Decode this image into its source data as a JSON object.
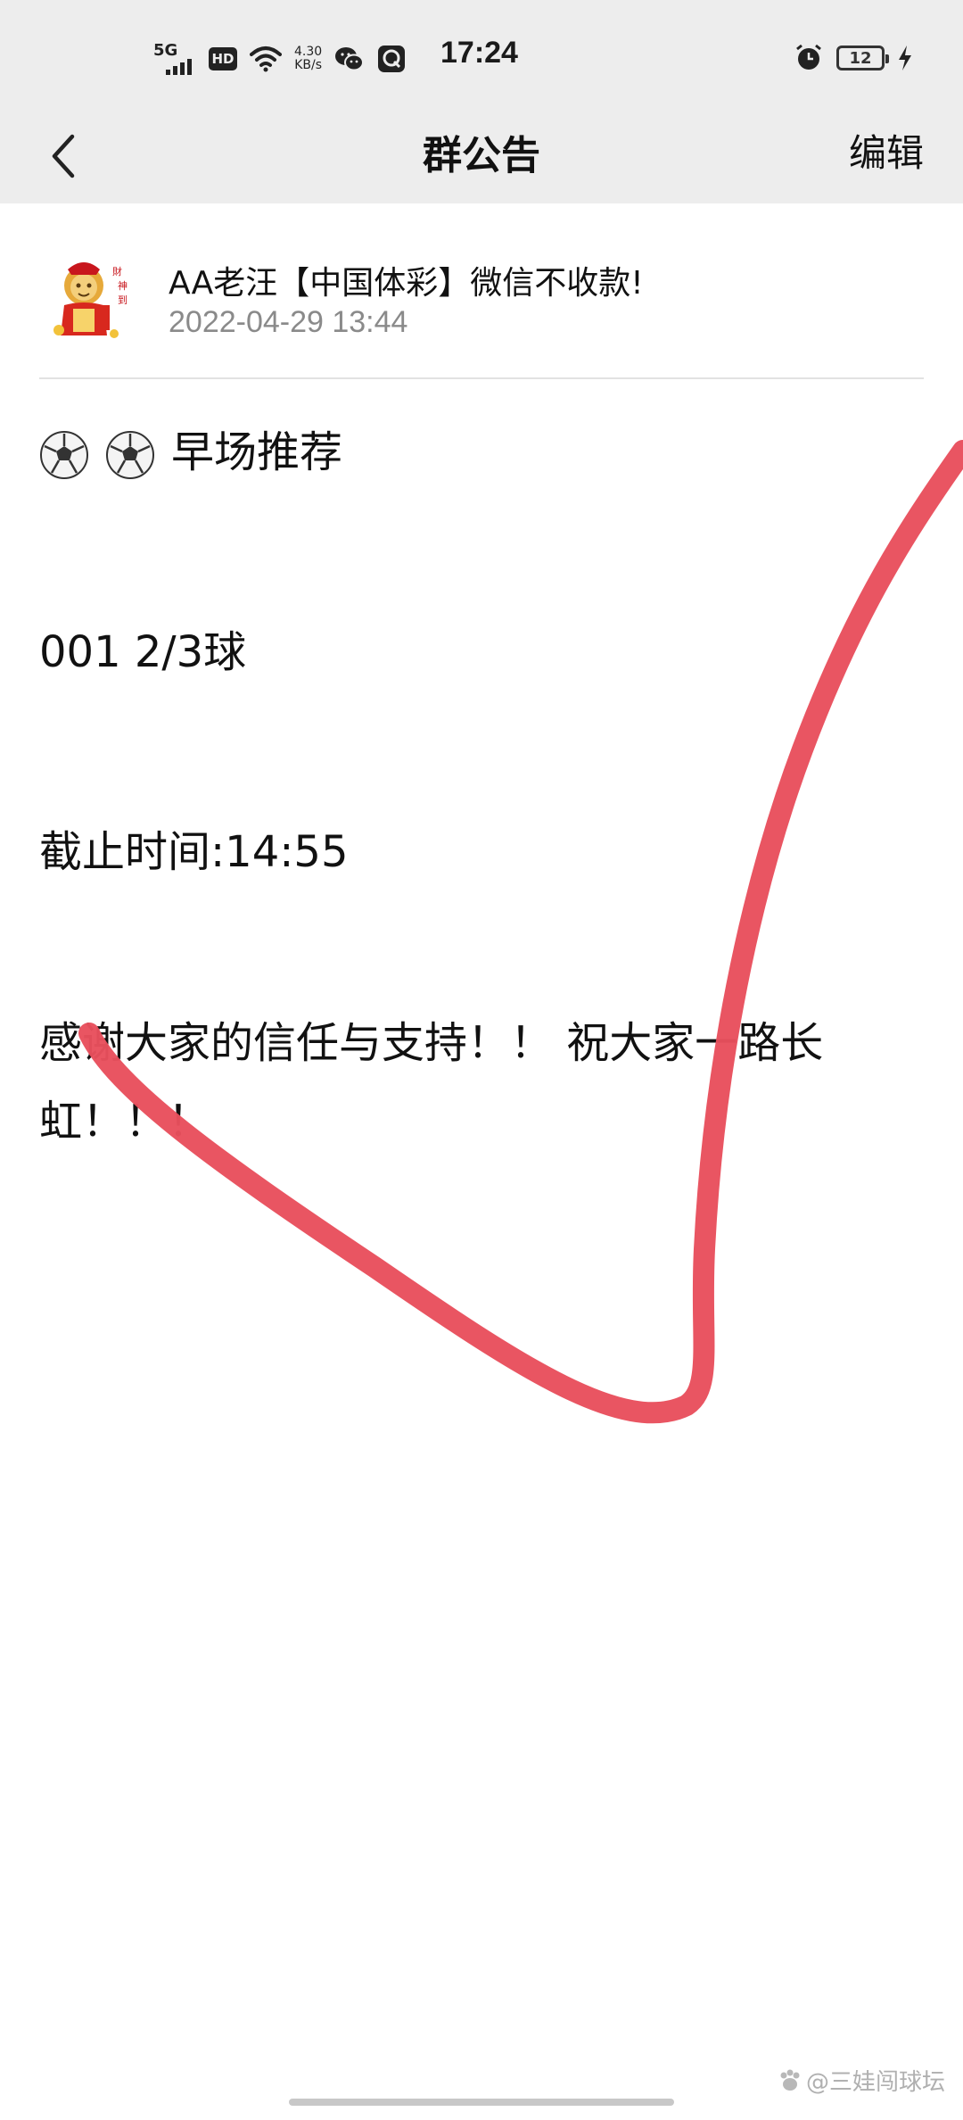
{
  "status_bar": {
    "network": "5G",
    "hd_badge": "HD",
    "net_speed_value": "4.30",
    "net_speed_unit": "KB/s",
    "time": "17:24",
    "battery_level": "12"
  },
  "nav": {
    "title": "群公告",
    "edit_label": "编辑"
  },
  "announcement": {
    "author": "AA老汪【中国体彩】微信不收款!",
    "timestamp": "2022-04-29 13:44",
    "line1_text": "早场推荐",
    "line2": "001  2/3球",
    "line3": "截止时间:14:55",
    "line4": "感谢大家的信任与支持！！ 祝大家一路长虹！！！"
  },
  "watermark": "@三娃闯球坛",
  "colors": {
    "topbar_bg": "#ededed",
    "scribble": "#e8505d",
    "timestamp_gray": "#8a8a8a"
  }
}
